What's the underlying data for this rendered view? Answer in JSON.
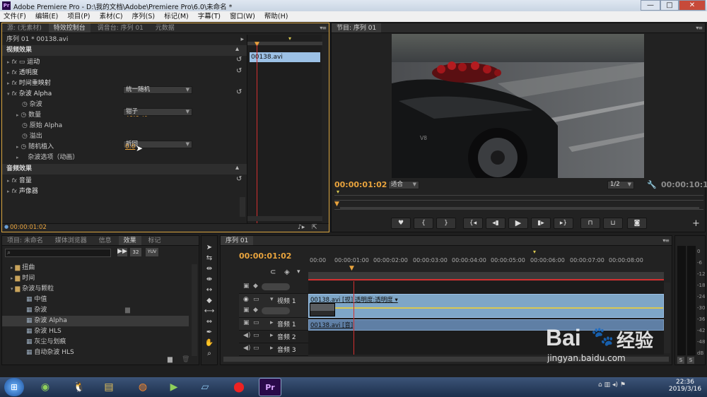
{
  "window": {
    "title": "Adobe Premiere Pro - D:\\我的文档\\Adobe\\Premiere Pro\\6.0\\未命名 *",
    "app_icon": "Pr",
    "min": "—",
    "max": "□",
    "close": "✕"
  },
  "menu": [
    "文件(F)",
    "编辑(E)",
    "项目(P)",
    "素材(C)",
    "序列(S)",
    "标记(M)",
    "字幕(T)",
    "窗口(W)",
    "帮助(H)"
  ],
  "effects_panel": {
    "tabs": [
      "源: (无素材)",
      "特效控制台",
      "调音台: 序列 01",
      "元数据"
    ],
    "sequence_label": "序列 01 * 00138.avi",
    "clip_name": "00138.avi",
    "video_header": "视频效果",
    "motion": "运动",
    "opacity": "透明度",
    "time_remap": "时间重映射",
    "noise_alpha": "杂波 Alpha",
    "noise": {
      "label": "杂波",
      "value": "统一随机"
    },
    "amount": {
      "label": "数量",
      "value": "40.0",
      "unit": "%"
    },
    "original_alpha": {
      "label": "原始 Alpha",
      "value": "钳子"
    },
    "overflow": {
      "label": "溢出",
      "value": "折回"
    },
    "random_seed": {
      "label": "随机植入",
      "value": "0.0"
    },
    "noise_options": "杂波选项（动画）",
    "audio_header": "音频效果",
    "volume": "音量",
    "panner": "声像器",
    "timecode": "00:00:01:02"
  },
  "program": {
    "tab": "节目: 序列 01",
    "timecode": "00:00:01:02",
    "fit": "适合",
    "resolution": "1/2",
    "duration": "00:00:10:12"
  },
  "project_panel": {
    "tabs": [
      "项目: 未命名",
      "媒体浏览器",
      "信息",
      "效果",
      "标记"
    ],
    "folders": [
      "扭曲",
      "时间",
      "杂波与颗粒"
    ],
    "items": [
      "中值",
      "杂波",
      "杂波 Alpha",
      "杂波 HLS",
      "灰尘与划痕",
      "自动杂波 HLS"
    ],
    "badges": [
      "32",
      "YUV"
    ]
  },
  "timeline": {
    "tab": "序列 01",
    "timecode": "00:00:01:02",
    "ruler": [
      "00:00",
      "00:00:01:00",
      "00:00:02:00",
      "00:00:03:00",
      "00:00:04:00",
      "00:00:05:00",
      "00:00:06:00",
      "00:00:07:00",
      "00:00:08:00"
    ],
    "video1": "视频 1",
    "audio1": "音频 1",
    "audio2": "音频 2",
    "audio3": "音频 3",
    "video_clip": "00138.avi [视] 透明度:透明度 ▾",
    "audio_clip": "00138.avi [音]"
  },
  "audio_meter": {
    "labels": [
      "0",
      "-6",
      "-12",
      "-18",
      "-24",
      "-30",
      "-36",
      "-42",
      "-48",
      "dB"
    ],
    "solo": "S"
  },
  "watermark": {
    "brand": "Bai",
    "brand2": "经验",
    "url": "jingyan.baidu.com"
  },
  "taskbar": {
    "time": "22:36",
    "date": "2019/3/16",
    "pr": "Pr"
  },
  "colors": {
    "accent": "#e8a33d",
    "playhead": "#d23030",
    "clip_video": "#7ea6c7",
    "clip_audio": "#5f7fa5",
    "selection": "#9cc1e6"
  }
}
